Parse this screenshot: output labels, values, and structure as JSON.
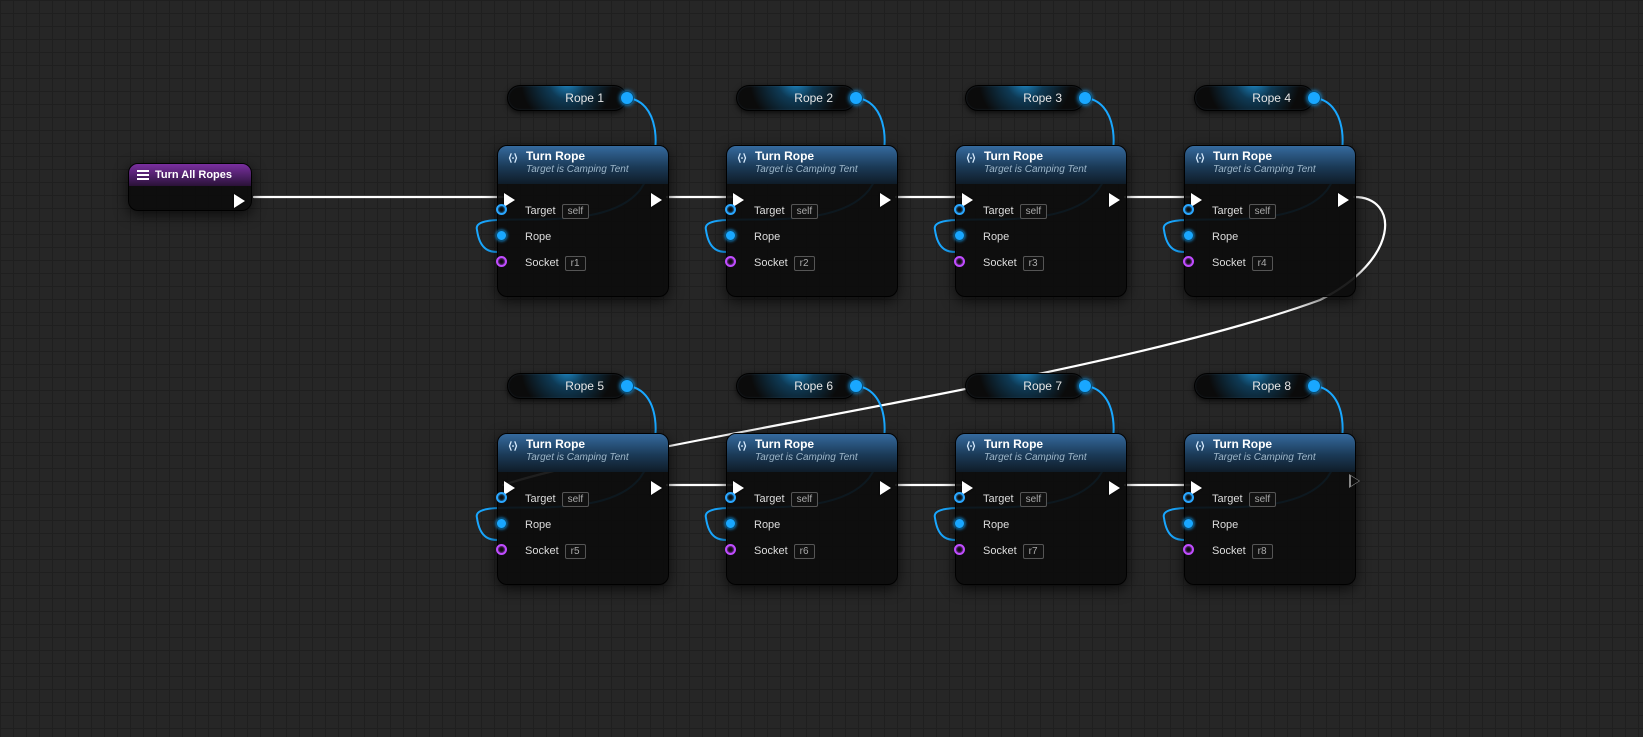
{
  "entry": {
    "title": "Turn All Ropes"
  },
  "function": {
    "title": "Turn Rope",
    "subtitle": "Target is Camping Tent",
    "pins": {
      "target": "Target",
      "targetDefault": "self",
      "rope": "Rope",
      "socket": "Socket"
    }
  },
  "vars": [
    {
      "label": "Rope 1"
    },
    {
      "label": "Rope 2"
    },
    {
      "label": "Rope 3"
    },
    {
      "label": "Rope 4"
    },
    {
      "label": "Rope 5"
    },
    {
      "label": "Rope 6"
    },
    {
      "label": "Rope 7"
    },
    {
      "label": "Rope 8"
    }
  ],
  "sockets": [
    "r1",
    "r2",
    "r3",
    "r4",
    "r5",
    "r6",
    "r7",
    "r8"
  ]
}
